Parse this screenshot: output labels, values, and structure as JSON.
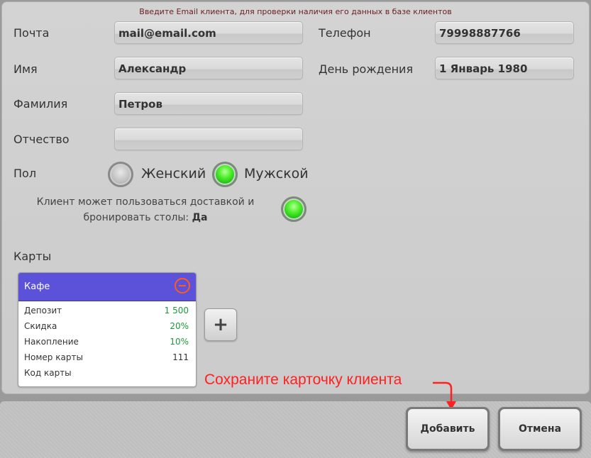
{
  "hint": "Введите Email клиента, для проверки наличия его данных в базе клиентов",
  "fields": {
    "email_label": "Почта",
    "email_value": "mail@email.com",
    "phone_label": "Телефон",
    "phone_value": "79998887766",
    "name_label": "Имя",
    "name_value": "Александр",
    "birthday_label": "День рождения",
    "birthday_value": "1 Январь 1980",
    "surname_label": "Фамилия",
    "surname_value": "Петров",
    "patronymic_label": "Отчество",
    "patronymic_value": ""
  },
  "gender": {
    "label": "Пол",
    "female": "Женский",
    "male": "Мужской",
    "selected": "male"
  },
  "delivery": {
    "line1": "Клиент может пользоваться доставкой и",
    "line2": "бронировать столы:",
    "value": "Да",
    "enabled": true
  },
  "cards": {
    "section_label": "Карты",
    "items": [
      {
        "title": "Кафе",
        "rows": [
          {
            "label": "Депозит",
            "value": "1 500"
          },
          {
            "label": "Скидка",
            "value": "20%"
          },
          {
            "label": "Накопление",
            "value": "10%"
          },
          {
            "label": "Номер карты",
            "value": "111"
          },
          {
            "label": "Код карты",
            "value": ""
          }
        ]
      }
    ],
    "add_label": "+"
  },
  "annotation": "Сохраните карточку клиента",
  "actions": {
    "add": "Добавить",
    "cancel": "Отмена"
  },
  "colors": {
    "card_header": "#5b52d9",
    "accent_green": "#1a9a3a",
    "annotation_red": "#ff2020",
    "hint_text": "#6a1f22"
  }
}
